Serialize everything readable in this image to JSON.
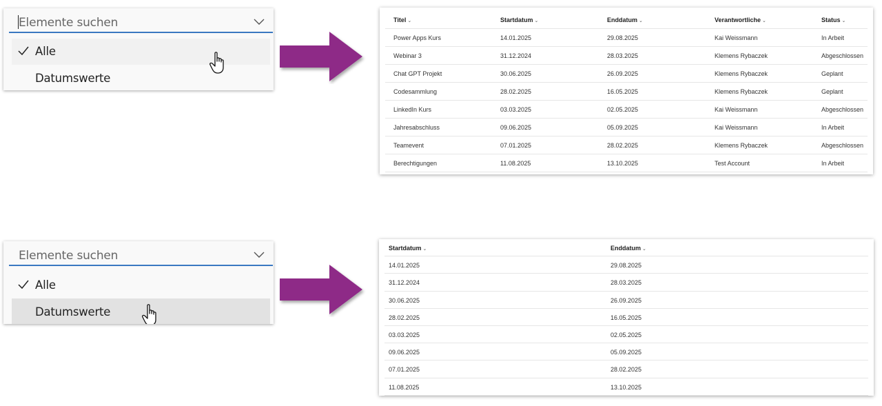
{
  "dropdowns": [
    {
      "placeholder": "Elemente suchen",
      "options": [
        {
          "label": "Alle",
          "checked": true,
          "highlight": "hover"
        },
        {
          "label": "Datumswerte",
          "checked": false,
          "highlight": "none"
        }
      ]
    },
    {
      "placeholder": "Elemente suchen",
      "options": [
        {
          "label": "Alle",
          "checked": true,
          "highlight": "none"
        },
        {
          "label": "Datumswerte",
          "checked": false,
          "highlight": "selected"
        }
      ]
    }
  ],
  "arrow_color": "#8e2a87",
  "full_table": {
    "columns": [
      "Titel",
      "Startdatum",
      "Enddatum",
      "Verantwortliche",
      "Status"
    ],
    "rows": [
      [
        "Power Apps Kurs",
        "14.01.2025",
        "29.08.2025",
        "Kai Weissmann",
        "In Arbeit"
      ],
      [
        "Webinar 3",
        "31.12.2024",
        "28.03.2025",
        "Klemens Rybaczek",
        "Abgeschlossen"
      ],
      [
        "Chat GPT Projekt",
        "30.06.2025",
        "26.09.2025",
        "Klemens Rybaczek",
        "Geplant"
      ],
      [
        "Codesammlung",
        "28.02.2025",
        "16.05.2025",
        "Klemens Rybaczek",
        "Geplant"
      ],
      [
        "LinkedIn Kurs",
        "03.03.2025",
        "02.05.2025",
        "Kai Weissmann",
        "Abgeschlossen"
      ],
      [
        "Jahresabschluss",
        "09.06.2025",
        "05.09.2025",
        "Kai Weissmann",
        "In Arbeit"
      ],
      [
        "Teamevent",
        "07.01.2025",
        "28.02.2025",
        "Klemens Rybaczek",
        "Abgeschlossen"
      ],
      [
        "Berechtigungen",
        "11.08.2025",
        "13.10.2025",
        "Test Account",
        "In Arbeit"
      ]
    ]
  },
  "date_table": {
    "columns": [
      "Startdatum",
      "Enddatum"
    ],
    "rows": [
      [
        "14.01.2025",
        "29.08.2025"
      ],
      [
        "31.12.2024",
        "28.03.2025"
      ],
      [
        "30.06.2025",
        "26.09.2025"
      ],
      [
        "28.02.2025",
        "16.05.2025"
      ],
      [
        "03.03.2025",
        "02.05.2025"
      ],
      [
        "09.06.2025",
        "05.09.2025"
      ],
      [
        "07.01.2025",
        "28.02.2025"
      ],
      [
        "11.08.2025",
        "13.10.2025"
      ]
    ]
  }
}
